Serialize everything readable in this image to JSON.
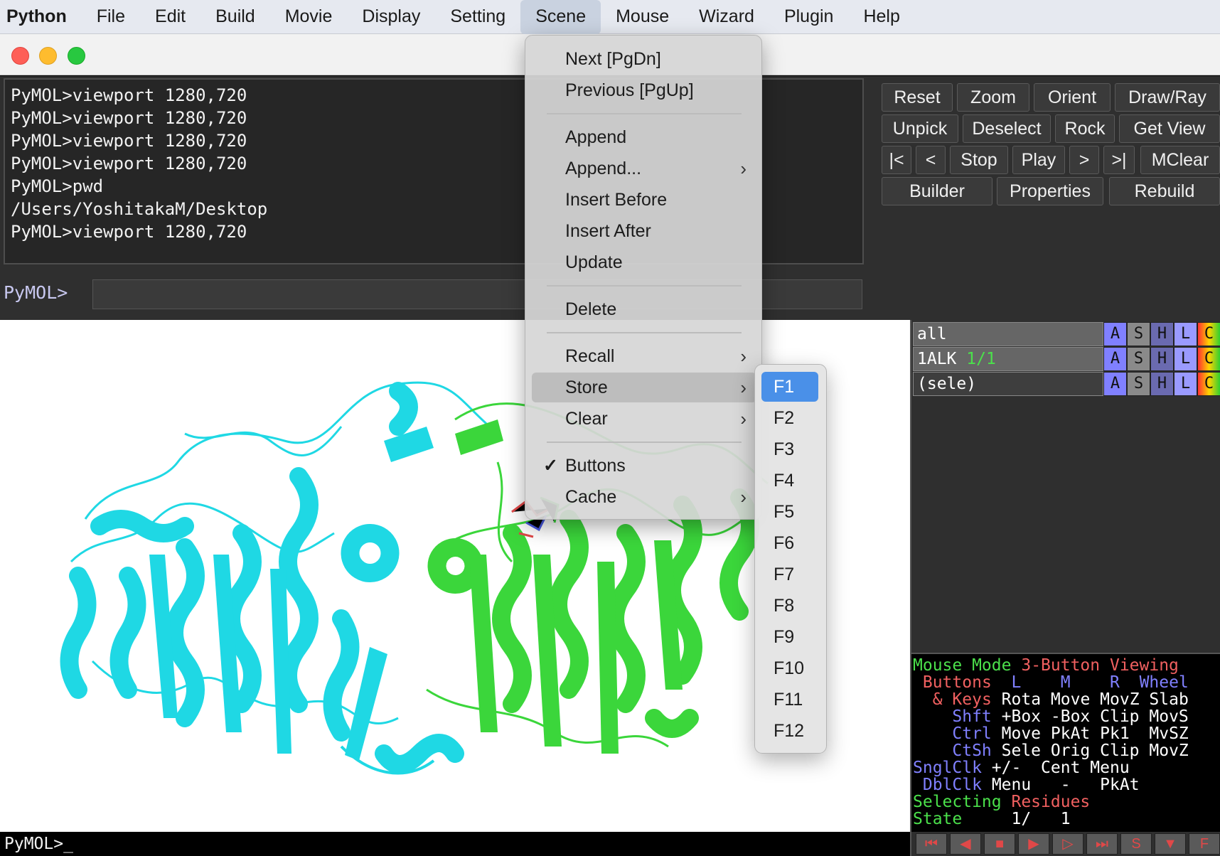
{
  "menubar": {
    "items": [
      "Python",
      "File",
      "Edit",
      "Build",
      "Movie",
      "Display",
      "Setting",
      "Scene",
      "Mouse",
      "Wizard",
      "Plugin",
      "Help"
    ],
    "active": "Scene"
  },
  "console": {
    "lines": [
      "PyMOL>viewport 1280,720",
      "PyMOL>viewport 1280,720",
      "PyMOL>viewport 1280,720",
      "PyMOL>viewport 1280,720",
      "PyMOL>pwd",
      "/Users/YoshitakaM/Desktop",
      "PyMOL>viewport 1280,720"
    ],
    "prompt": "PyMOL>",
    "input_value": ""
  },
  "buttons": {
    "row1": [
      "Reset",
      "Zoom",
      "Orient",
      "Draw/Ray"
    ],
    "row2": [
      "Unpick",
      "Deselect",
      "Rock",
      "Get View"
    ],
    "row3": [
      "|<",
      "<",
      "Stop",
      "Play",
      ">",
      ">|",
      "MClear"
    ],
    "row4": [
      "Builder",
      "Properties",
      "Rebuild"
    ]
  },
  "objects": [
    {
      "name": "all",
      "frame": ""
    },
    {
      "name": "1ALK",
      "frame": "1/1"
    },
    {
      "name": "(sele)",
      "frame": ""
    }
  ],
  "object_actions": [
    "A",
    "S",
    "H",
    "L",
    "C"
  ],
  "mouse_panel": {
    "title": "Mouse Mode",
    "mode": "3-Button Viewing",
    "header": [
      "Buttons",
      "L",
      "M",
      "R",
      "Wheel"
    ],
    "rows": [
      {
        "key": "& Keys",
        "vals": [
          "Rota",
          "Move",
          "MovZ",
          "Slab"
        ]
      },
      {
        "key": "Shft",
        "vals": [
          "+Box",
          "-Box",
          "Clip",
          "MovS"
        ]
      },
      {
        "key": "Ctrl",
        "vals": [
          "Move",
          "PkAt",
          "Pk1",
          "MvSZ"
        ]
      },
      {
        "key": "CtSh",
        "vals": [
          "Sele",
          "Orig",
          "Clip",
          "MovZ"
        ]
      },
      {
        "key": "SnglClk",
        "vals": [
          "+/-",
          "Cent",
          "Menu",
          ""
        ]
      },
      {
        "key": "DblClk",
        "vals": [
          "Menu",
          "-",
          "PkAt",
          ""
        ]
      }
    ],
    "selecting_label": "Selecting",
    "selecting_value": "Residues",
    "state_label": "State",
    "state_value": "1/",
    "state_total": "1"
  },
  "movie_controls": [
    "⏮",
    "◀",
    "■",
    "▶",
    "▷",
    "⏭",
    "S",
    "▼",
    "F"
  ],
  "bottom_prompt": "PyMOL>_",
  "scene_menu": {
    "items": [
      {
        "label": "Next [PgDn]"
      },
      {
        "label": "Previous [PgUp]"
      },
      {
        "label": "Append"
      },
      {
        "label": "Append...",
        "submenu": true
      },
      {
        "label": "Insert Before"
      },
      {
        "label": "Insert After"
      },
      {
        "label": "Update"
      },
      {
        "label": "Delete"
      },
      {
        "label": "Recall",
        "submenu": true
      },
      {
        "label": "Store",
        "submenu": true,
        "highlighted": true
      },
      {
        "label": "Clear",
        "submenu": true
      },
      {
        "label": "Buttons",
        "checked": true
      },
      {
        "label": "Cache",
        "submenu": true
      }
    ],
    "checkmark": "✓",
    "chevron": "›"
  },
  "store_submenu": {
    "items": [
      "F1",
      "F2",
      "F3",
      "F4",
      "F5",
      "F6",
      "F7",
      "F8",
      "F9",
      "F10",
      "F11",
      "F12"
    ],
    "selected": "F1"
  },
  "colors": {
    "cyan_chain": "#1fd8e4",
    "green_chain": "#3bd63b",
    "menu_highlight": "#4a90e8"
  }
}
